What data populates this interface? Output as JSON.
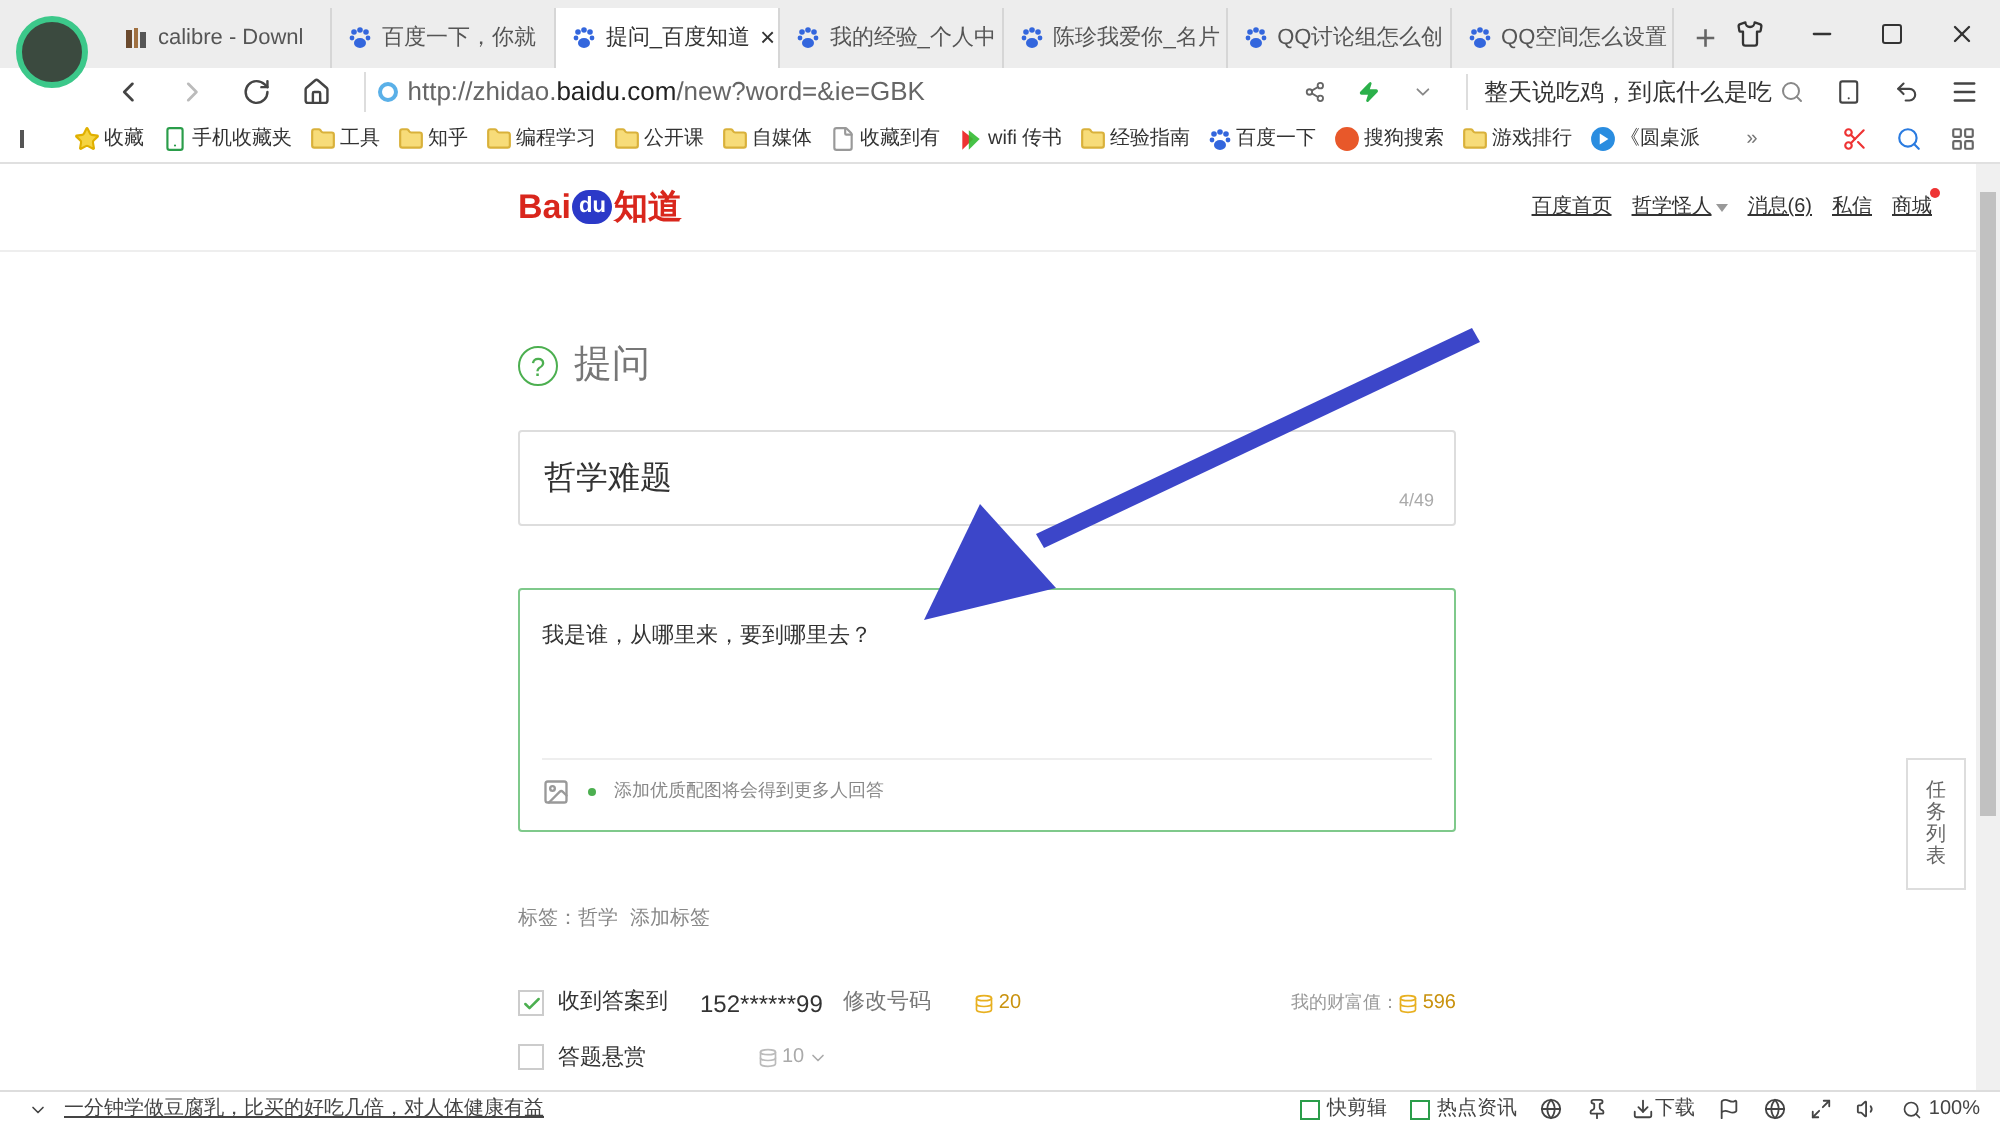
{
  "tabs": [
    {
      "label": "calibre - Downl",
      "kind": "book",
      "selected": false
    },
    {
      "label": "百度一下，你就",
      "kind": "paw",
      "selected": false
    },
    {
      "label": "提问_百度知道",
      "kind": "paw",
      "selected": true,
      "close": "×"
    },
    {
      "label": "我的经验_个人中",
      "kind": "paw",
      "selected": false
    },
    {
      "label": "陈珍我爱你_名片",
      "kind": "paw",
      "selected": false
    },
    {
      "label": "QQ讨论组怎么创",
      "kind": "paw",
      "selected": false
    },
    {
      "label": "QQ空间怎么设置",
      "kind": "paw",
      "selected": false
    }
  ],
  "new_tab": "+",
  "address": {
    "prefix": "http://zhidao.",
    "domain": "baidu.com",
    "rest": "/new?word=&ie=GBK"
  },
  "search": {
    "value": "整天说吃鸡，到底什么是吃"
  },
  "bookmarks": [
    {
      "label": "收藏",
      "kind": "star"
    },
    {
      "label": "手机收藏夹",
      "kind": "phone"
    },
    {
      "label": "工具",
      "kind": "folder"
    },
    {
      "label": "知乎",
      "kind": "folder"
    },
    {
      "label": "编程学习",
      "kind": "folder"
    },
    {
      "label": "公开课",
      "kind": "folder"
    },
    {
      "label": "自媒体",
      "kind": "folder"
    },
    {
      "label": "收藏到有",
      "kind": "page"
    },
    {
      "label": "wifi 传书",
      "kind": "wifi"
    },
    {
      "label": "经验指南",
      "kind": "folder"
    },
    {
      "label": "百度一下",
      "kind": "paw"
    },
    {
      "label": "搜狗搜索",
      "kind": "sogou"
    },
    {
      "label": "游戏排行",
      "kind": "folder"
    },
    {
      "label": "《圆桌派",
      "kind": "play"
    }
  ],
  "bookmarks_more": "»",
  "site": {
    "logo_bai": "Bai",
    "logo_du": "du",
    "logo_name": "知道",
    "nav": [
      {
        "label": "百度首页",
        "dropdown": false,
        "dot": false
      },
      {
        "label": "哲学怪人",
        "dropdown": true,
        "dot": false
      },
      {
        "label": "消息(6)",
        "dropdown": false,
        "dot": false
      },
      {
        "label": "私信",
        "dropdown": false,
        "dot": false
      },
      {
        "label": "商城",
        "dropdown": false,
        "dot": true
      }
    ]
  },
  "form": {
    "question_mark": "?",
    "heading": "提问",
    "title_value": "哲学难题",
    "title_count": "4/49",
    "body_value": "我是谁，从哪里来，要到哪里去？",
    "image_hint": "添加优质配图将会得到更多人回答",
    "tags_label": "标签：哲学",
    "add_tag": "添加标签",
    "options": [
      {
        "label": "收到答案到",
        "checked": true,
        "phone": "152******99",
        "edit": "修改号码",
        "coins": "20",
        "wealth_label": "我的财富值：",
        "wealth": "596"
      },
      {
        "label": "答题悬赏",
        "checked": false,
        "coins": "10"
      }
    ]
  },
  "task_list": "任务列表",
  "status": {
    "news": "一分钟学做豆腐乳，比买的好吃几倍，对人体健康有益",
    "clip": "快剪辑",
    "hot": "热点资讯",
    "download": "下载",
    "zoom": "100%"
  }
}
